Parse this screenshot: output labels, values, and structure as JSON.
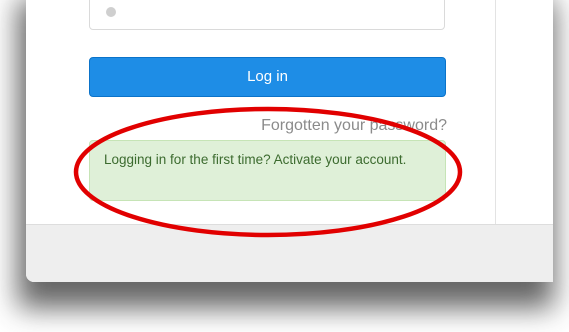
{
  "login_form": {
    "login_button_label": "Log in",
    "forgot_password_link": "Forgotten your password?",
    "first_time_notice": "Logging in for the first time? Activate your account."
  },
  "annotation": {
    "shape": "ellipse",
    "color": "#e10000",
    "target": "first-time-notice"
  },
  "colors": {
    "button": "#1e8de6",
    "notice_background": "#dff0d8",
    "notice_text": "#3c6b2f",
    "link_text": "#8b8b8b",
    "footer": "#eeeeee"
  }
}
